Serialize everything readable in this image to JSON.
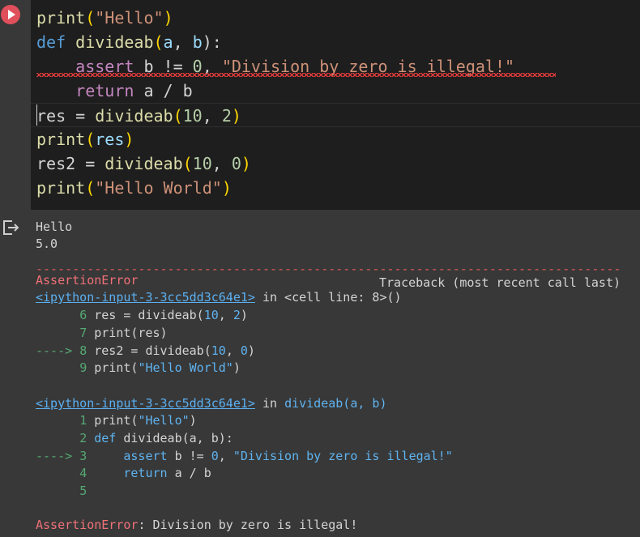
{
  "cell": {
    "run_icon": "play-icon",
    "code_lines": [
      [
        "print",
        "(",
        "\"Hello\"",
        ")"
      ],
      [
        "def",
        "divideab",
        "(",
        "a",
        ", ",
        "b",
        "):"
      ],
      [
        "    ",
        "assert",
        " b != ",
        "0",
        ", ",
        "\"Division by zero is illegal!\""
      ],
      [
        "    ",
        "return",
        " a / b"
      ],
      [
        "res = ",
        "divideab",
        "(",
        "10",
        ", ",
        "2",
        ")"
      ],
      [
        "print",
        "(",
        "res",
        ")"
      ],
      [
        "res2 = ",
        "divideab",
        "(",
        "10",
        ", ",
        "0",
        ")"
      ],
      [
        "print",
        "(",
        "\"Hello World\"",
        ")"
      ]
    ]
  },
  "output": {
    "icon": "output-exit-icon",
    "stdout": [
      "Hello",
      "5.0"
    ],
    "dashes": "-----------------------------------------------------------------------------------------------------",
    "error_name": "AssertionError",
    "traceback_header": "Traceback (most recent call last)",
    "frame1": {
      "link": "<ipython-input-3-3cc5dd3c64e1>",
      "location": " in <cell line: 8>()",
      "lines": [
        {
          "marker": "      ",
          "num": "6",
          "code": [
            "res = divideab(",
            "10",
            ", ",
            "2",
            ")"
          ]
        },
        {
          "marker": "      ",
          "num": "7",
          "code": [
            "print(res)"
          ]
        },
        {
          "marker": "----> ",
          "num": "8",
          "code": [
            "res2 = divideab(",
            "10",
            ", ",
            "0",
            ")"
          ]
        },
        {
          "marker": "      ",
          "num": "9",
          "code": [
            "print(",
            "\"Hello World\"",
            ")"
          ]
        }
      ]
    },
    "frame2": {
      "link": "<ipython-input-3-3cc5dd3c64e1>",
      "location_in": " in ",
      "location_fn": "divideab(a, b)",
      "lines": [
        {
          "marker": "      ",
          "num": "1",
          "code": [
            "print(",
            "\"Hello\"",
            ")"
          ]
        },
        {
          "marker": "      ",
          "num": "2",
          "code": [
            "def",
            " divideab(a, b):"
          ]
        },
        {
          "marker": "----> ",
          "num": "3",
          "code": [
            "    assert",
            " b != ",
            "0",
            ", ",
            "\"Division by zero is illegal!\""
          ]
        },
        {
          "marker": "      ",
          "num": "4",
          "code": [
            "    return",
            " a / b"
          ]
        },
        {
          "marker": "      ",
          "num": "5",
          "code": [
            ""
          ]
        }
      ]
    },
    "final_error_name": "AssertionError",
    "final_error_msg": ": Division by zero is illegal!"
  }
}
